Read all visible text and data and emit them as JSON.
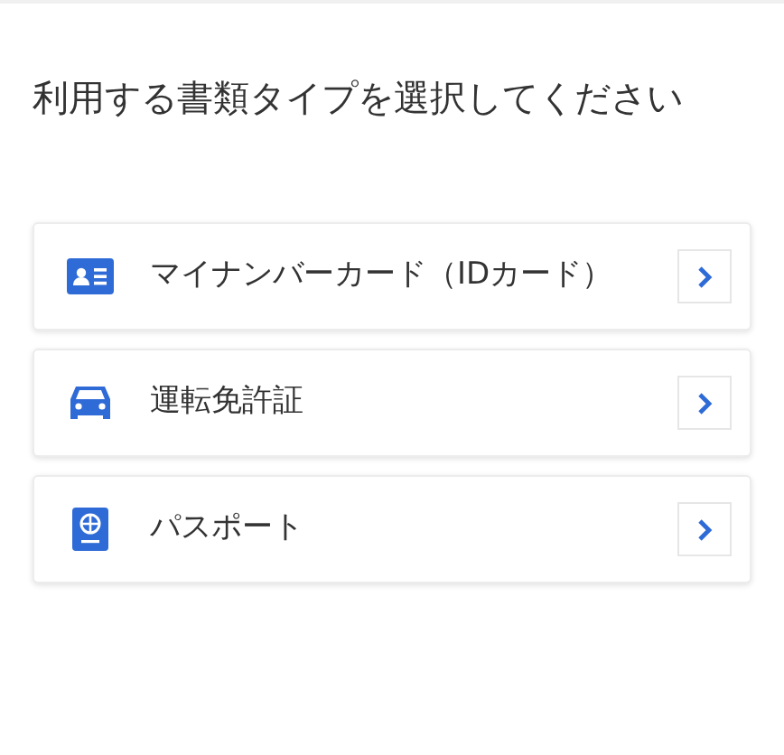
{
  "title": "利用する書類タイプを選択してください",
  "options": [
    {
      "kind": "id_card",
      "label": "マイナンバーカード（IDカード）"
    },
    {
      "kind": "car",
      "label": "運転免許証"
    },
    {
      "kind": "passport",
      "label": "パスポート"
    }
  ]
}
